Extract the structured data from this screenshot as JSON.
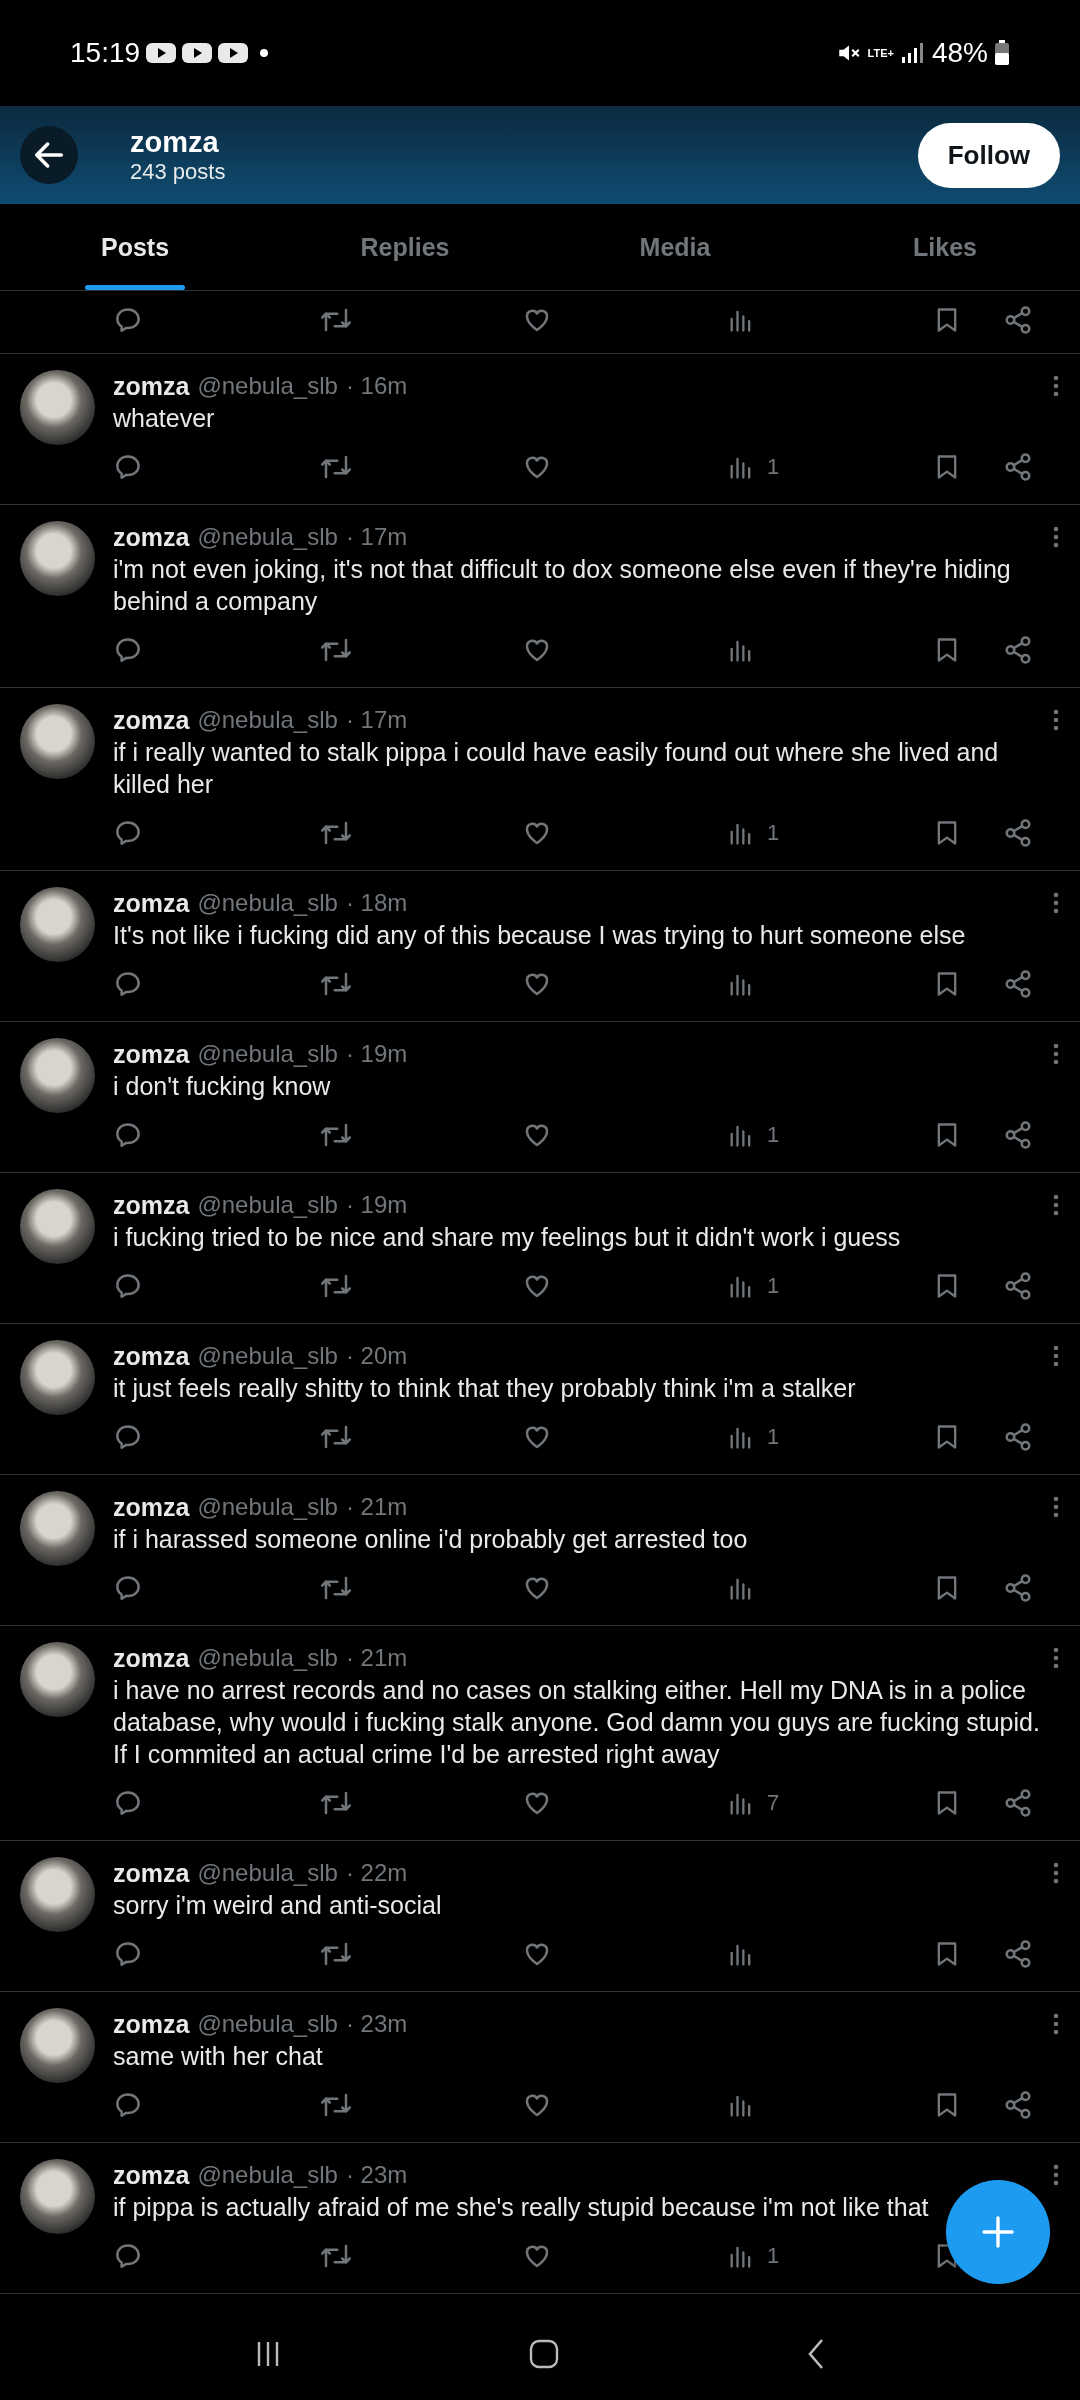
{
  "status_bar": {
    "time": "15:19",
    "network": "LTE+",
    "battery": "48%"
  },
  "header": {
    "name": "zomza",
    "posts_count": "243 posts",
    "follow_button": "Follow"
  },
  "tabs": [
    {
      "label": "Posts",
      "selected": true
    },
    {
      "label": "Replies",
      "selected": false
    },
    {
      "label": "Media",
      "selected": false
    },
    {
      "label": "Likes",
      "selected": false
    }
  ],
  "posts": [
    {
      "name": "zomza",
      "handle": "@nebula_slb",
      "time": "· 16m",
      "text": "whatever",
      "views": "1"
    },
    {
      "name": "zomza",
      "handle": "@nebula_slb",
      "time": "· 17m",
      "text": "i'm not even joking, it's not that difficult to dox someone else even if they're hiding behind a company"
    },
    {
      "name": "zomza",
      "handle": "@nebula_slb",
      "time": "· 17m",
      "text": "if i really wanted to stalk pippa i could have easily found out where she lived and killed her",
      "views": "1"
    },
    {
      "name": "zomza",
      "handle": "@nebula_slb",
      "time": "· 18m",
      "text": "It's not like i fucking did any of this because I was trying to hurt someone else"
    },
    {
      "name": "zomza",
      "handle": "@nebula_slb",
      "time": "· 19m",
      "text": "i don't fucking know",
      "views": "1"
    },
    {
      "name": "zomza",
      "handle": "@nebula_slb",
      "time": "· 19m",
      "text": "i fucking tried to be nice and share my feelings but it didn't work i guess",
      "views": "1"
    },
    {
      "name": "zomza",
      "handle": "@nebula_slb",
      "time": "· 20m",
      "text": "it just feels really shitty to think that they probably think i'm a stalker",
      "views": "1"
    },
    {
      "name": "zomza",
      "handle": "@nebula_slb",
      "time": "· 21m",
      "text": "if i harassed someone online i'd probably get arrested too"
    },
    {
      "name": "zomza",
      "handle": "@nebula_slb",
      "time": "· 21m",
      "text": "i have no arrest records and no cases on stalking either. Hell my DNA is in a police database, why would i fucking stalk anyone. God damn you guys are fucking stupid. If I commited an actual crime I'd be arrested right away",
      "views": "7"
    },
    {
      "name": "zomza",
      "handle": "@nebula_slb",
      "time": "· 22m",
      "text": "sorry i'm weird and anti-social"
    },
    {
      "name": "zomza",
      "handle": "@nebula_slb",
      "time": "· 23m",
      "text": "same with her chat"
    },
    {
      "name": "zomza",
      "handle": "@nebula_slb",
      "time": "· 23m",
      "text": "if pippa is actually afraid of me she's really stupid because i'm not like that",
      "views": "1"
    }
  ]
}
